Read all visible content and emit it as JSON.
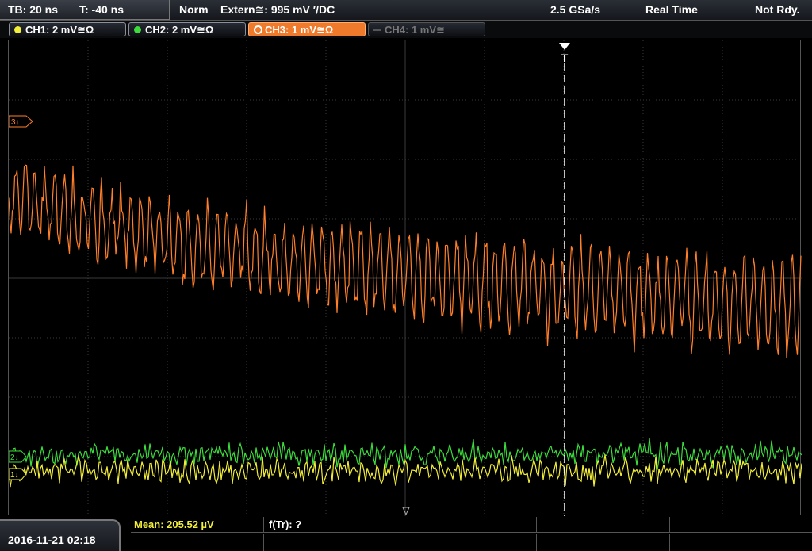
{
  "topbar": {
    "timebase": "TB: 20 ns",
    "trigger_time": "T: -40 ns",
    "trigger_mode": "Norm",
    "trigger_source": "Extern≅: 995 mV ′/DC",
    "sample_rate": "2.5 GSa/s",
    "acq_mode": "Real Time",
    "status": "Not Rdy."
  },
  "channels": [
    {
      "label": "CH1: 2 mV≅Ω",
      "color": "#f2ee3a",
      "state": "on"
    },
    {
      "label": "CH2: 2 mV≅Ω",
      "color": "#3cdc3c",
      "state": "on"
    },
    {
      "label": "CH3: 1 mV≅Ω",
      "color": "#ff8a3a",
      "state": "active"
    },
    {
      "label": "CH4: 1 mV≅",
      "color": "#666666",
      "state": "off"
    }
  ],
  "markers": {
    "ch3": "3↓",
    "ch2": "2↓",
    "ch1": "1↓",
    "trigger": "T"
  },
  "bottom": {
    "datetime": "2016-11-21 02:18",
    "mean_label": "Mean: 205.52 µV",
    "freq_label": "f(Tr): ?"
  },
  "colors": {
    "ch1": "#f2ee3a",
    "ch2": "#3cdc3c",
    "ch3": "#ff7f2a",
    "grid": "#3a3a3a"
  }
}
